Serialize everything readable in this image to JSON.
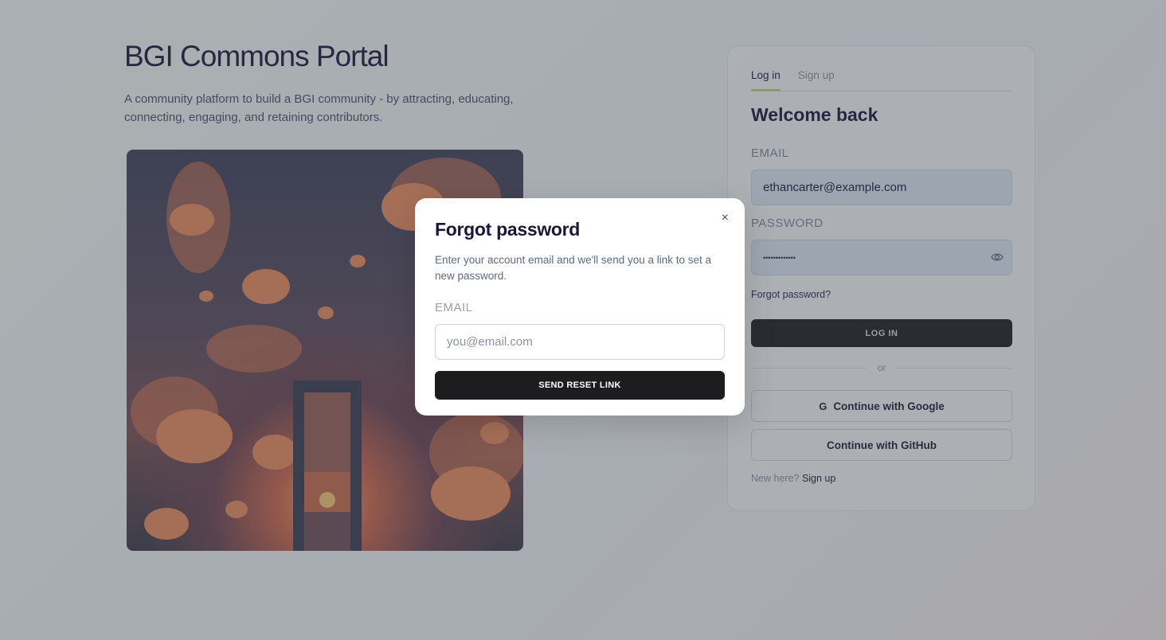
{
  "hero": {
    "title": "BGI Commons Portal",
    "subtitle": "A community platform to build a BGI community - by attracting, educating, connecting, engaging, and retaining contributors."
  },
  "auth": {
    "tabs": [
      {
        "label": "Log in",
        "active": true
      },
      {
        "label": "Sign up",
        "active": false
      }
    ],
    "heading": "Welcome back",
    "email_label": "EMAIL",
    "email_value": "ethancarter@example.com",
    "password_label": "PASSWORD",
    "password_value": "•••••••••••••",
    "forgot_link": "Forgot password?",
    "login_button": "LOG IN",
    "divider_text": "or",
    "google_glyph": "G",
    "google_button": "Continue with Google",
    "github_button": "Continue with GitHub",
    "new_here": "New here?",
    "signup_link": "Sign up",
    "accent_color": "#e1b75a"
  },
  "modal": {
    "title": "Forgot password",
    "close_glyph": "×",
    "description": "Enter your account email and we'll send you a link to set a new password.",
    "email_label": "EMAIL",
    "email_placeholder": "you@email.com",
    "send_button": "SEND RESET LINK"
  }
}
